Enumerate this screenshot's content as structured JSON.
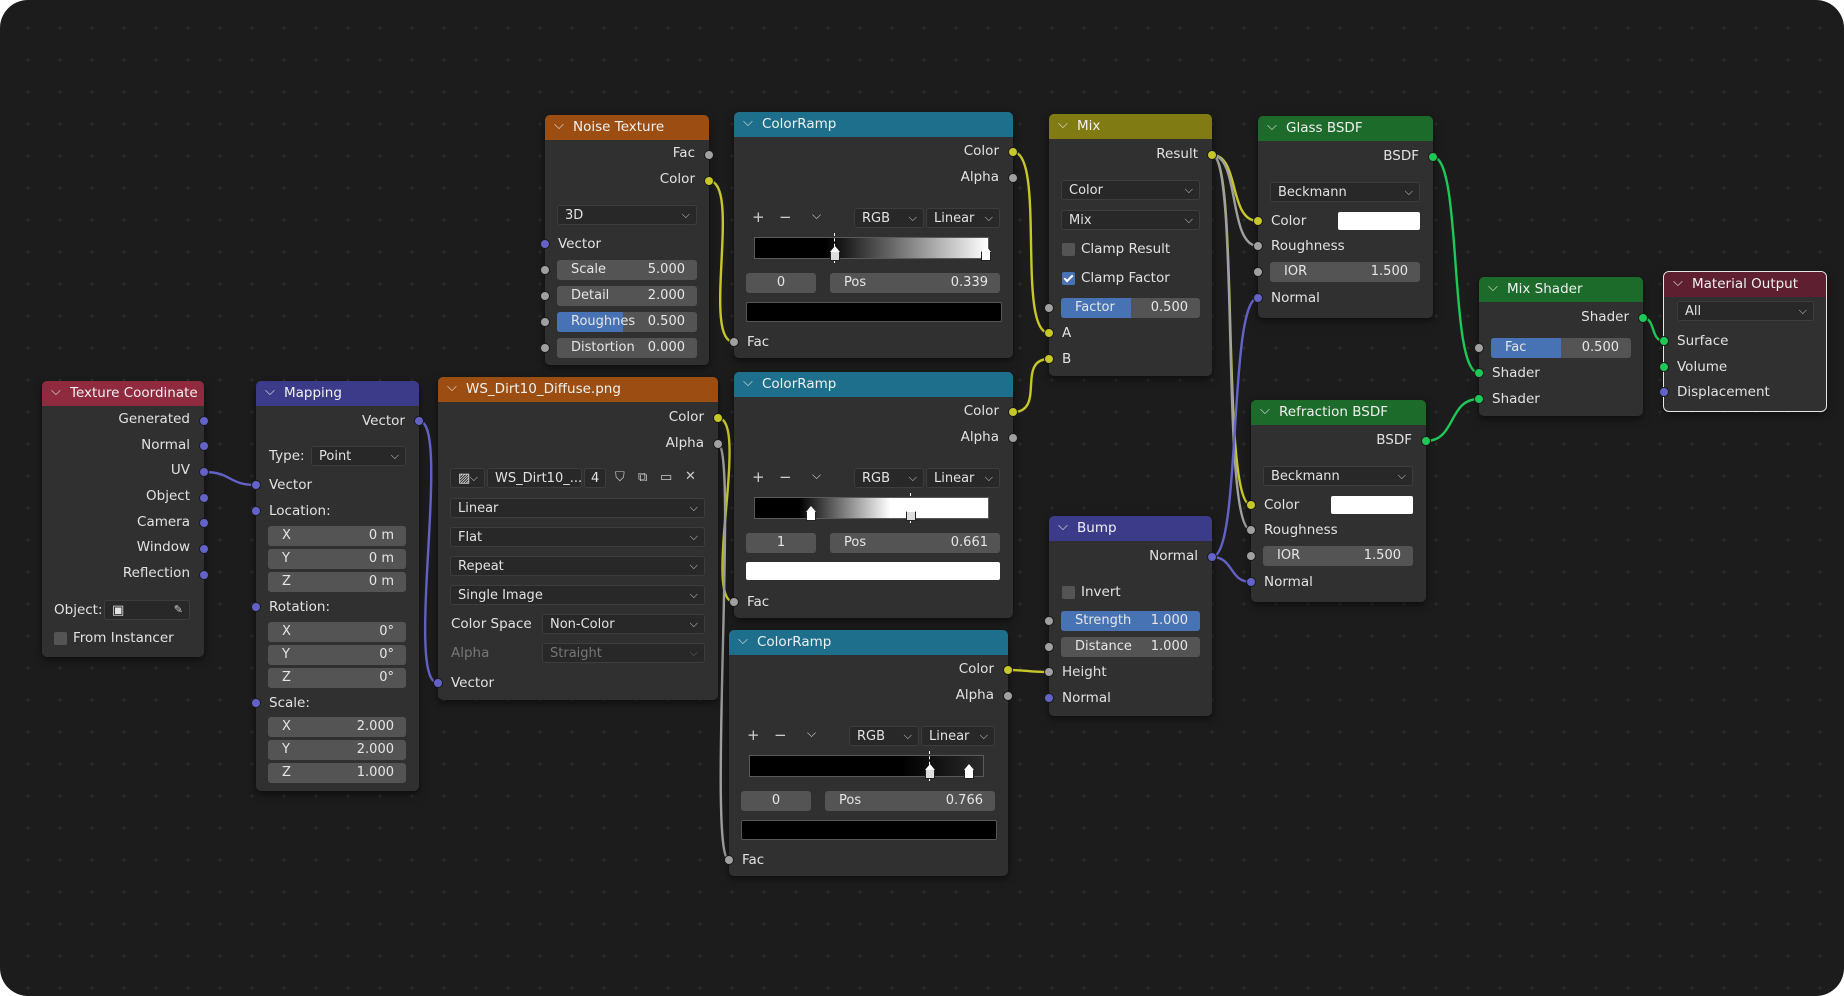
{
  "texcoord": {
    "title": "Texture Coordinate",
    "outputs": [
      "Generated",
      "Normal",
      "UV",
      "Object",
      "Camera",
      "Window",
      "Reflection"
    ],
    "object_label": "Object:",
    "from_instancer": "From Instancer"
  },
  "mapping": {
    "title": "Mapping",
    "output": "Vector",
    "type_label": "Type:",
    "type_value": "Point",
    "input_vector": "Vector",
    "location": {
      "label": "Location:",
      "x": {
        "k": "X",
        "v": "0 m"
      },
      "y": {
        "k": "Y",
        "v": "0 m"
      },
      "z": {
        "k": "Z",
        "v": "0 m"
      }
    },
    "rotation": {
      "label": "Rotation:",
      "x": {
        "k": "X",
        "v": "0°"
      },
      "y": {
        "k": "Y",
        "v": "0°"
      },
      "z": {
        "k": "Z",
        "v": "0°"
      }
    },
    "scale": {
      "label": "Scale:",
      "x": {
        "k": "X",
        "v": "2.000"
      },
      "y": {
        "k": "Y",
        "v": "2.000"
      },
      "z": {
        "k": "Z",
        "v": "1.000"
      }
    }
  },
  "image": {
    "title": "WS_Dirt10_Diffuse.png",
    "outputs": [
      "Color",
      "Alpha"
    ],
    "file_short": "WS_Dirt10_...",
    "users": "4",
    "interpolation": "Linear",
    "projection": "Flat",
    "extension": "Repeat",
    "source": "Single Image",
    "color_space_label": "Color Space",
    "color_space": "Non-Color",
    "alpha_label": "Alpha",
    "alpha_mode": "Straight",
    "input_vector": "Vector"
  },
  "noise": {
    "title": "Noise Texture",
    "outputs": [
      "Fac",
      "Color"
    ],
    "dimensions": "3D",
    "input_vector": "Vector",
    "fields": [
      {
        "k": "Scale",
        "v": "5.000"
      },
      {
        "k": "Detail",
        "v": "2.000"
      },
      {
        "k": "Roughnes",
        "v": "0.500",
        "fill": 0.5
      },
      {
        "k": "Distortion",
        "v": "0.000"
      }
    ]
  },
  "ramp1": {
    "title": "ColorRamp",
    "outputs": [
      "Color",
      "Alpha"
    ],
    "mode": "RGB",
    "interp": "Linear",
    "index": "0",
    "pos_label": "Pos",
    "pos": "0.339",
    "input": "Fac"
  },
  "ramp2": {
    "title": "ColorRamp",
    "outputs": [
      "Color",
      "Alpha"
    ],
    "mode": "RGB",
    "interp": "Linear",
    "index": "1",
    "pos_label": "Pos",
    "pos": "0.661",
    "input": "Fac"
  },
  "ramp3": {
    "title": "ColorRamp",
    "outputs": [
      "Color",
      "Alpha"
    ],
    "mode": "RGB",
    "interp": "Linear",
    "index": "0",
    "pos_label": "Pos",
    "pos": "0.766",
    "input": "Fac"
  },
  "mix": {
    "title": "Mix",
    "output": "Result",
    "data_type": "Color",
    "blend": "Mix",
    "clamp_result": "Clamp Result",
    "clamp_factor": "Clamp Factor",
    "factor": {
      "k": "Factor",
      "v": "0.500",
      "fill": 0.5
    },
    "a": "A",
    "b": "B"
  },
  "bump": {
    "title": "Bump",
    "output": "Normal",
    "invert": "Invert",
    "strength": {
      "k": "Strength",
      "v": "1.000",
      "fill": 1.0
    },
    "distance": {
      "k": "Distance",
      "v": "1.000"
    },
    "height": "Height",
    "normal": "Normal"
  },
  "glass": {
    "title": "Glass BSDF",
    "output": "BSDF",
    "distribution": "Beckmann",
    "color": "Color",
    "roughness": "Roughness",
    "ior": {
      "k": "IOR",
      "v": "1.500"
    },
    "normal": "Normal"
  },
  "refraction": {
    "title": "Refraction BSDF",
    "output": "BSDF",
    "distribution": "Beckmann",
    "color": "Color",
    "roughness": "Roughness",
    "ior": {
      "k": "IOR",
      "v": "1.500"
    },
    "normal": "Normal"
  },
  "mixshader": {
    "title": "Mix Shader",
    "output": "Shader",
    "fac": {
      "k": "Fac",
      "v": "0.500",
      "fill": 0.5
    },
    "in1": "Shader",
    "in2": "Shader"
  },
  "output": {
    "title": "Material Output",
    "target": "All",
    "inputs": [
      "Surface",
      "Volume",
      "Displacement"
    ]
  },
  "colors": {
    "background": "#1c1c1c",
    "node_body": "#303030",
    "header_input": "#8f2a3f",
    "header_vector": "#3b3b8a",
    "header_texture": "#9c4e12",
    "header_converter": "#1d6f8c",
    "header_color": "#807b12",
    "header_shader": "#1c6b2a",
    "header_output": "#5e2030",
    "socket_float": "#a0a0a0",
    "socket_color": "#c7c729",
    "socket_vector": "#6363c7",
    "socket_shader": "#1ec756",
    "accent": "#4772b3"
  }
}
